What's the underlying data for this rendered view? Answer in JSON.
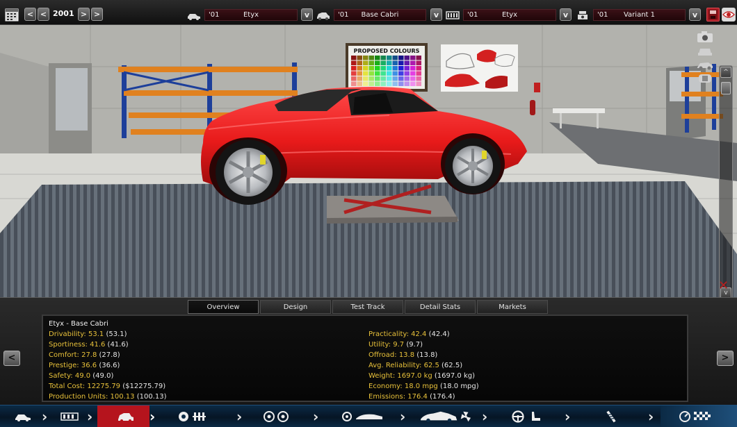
{
  "topbar": {
    "calendar_icon": "calendar-icon",
    "year": "2001",
    "prev_label": "<",
    "prev_fast_label": "<",
    "next_label": ">",
    "next_fast_label": ">",
    "dropdown_label": "v",
    "selectors": [
      {
        "year": "'01",
        "name": "Etyx",
        "icon": "car-factory-icon"
      },
      {
        "year": "'01",
        "name": "Base Cabri",
        "icon": "car-body-icon"
      },
      {
        "year": "'01",
        "name": "Etyx",
        "icon": "engine-block-icon"
      },
      {
        "year": "'01",
        "name": "Variant 1",
        "icon": "engine-variant-icon"
      }
    ],
    "save_icon": "save-icon",
    "view_icon": "eye-icon"
  },
  "scene": {
    "poster_text": "PROPOSED COLOURS",
    "car_color": "#e81a1a",
    "scroll_up": "^",
    "scroll_down": "v",
    "close_icon": "close-icon",
    "view_icons": [
      "camera-icon",
      "car-front-icon",
      "car-side-icon",
      "car-top-icon"
    ]
  },
  "tabs": [
    "Overview",
    "Design",
    "Test Track",
    "Detail Stats",
    "Markets"
  ],
  "active_tab": "Overview",
  "stats": {
    "title": "Etyx - Base Cabri",
    "left": [
      {
        "label": "Drivability:",
        "value": "53.1",
        "ref": "(53.1)"
      },
      {
        "label": "Sportiness:",
        "value": "41.6",
        "ref": "(41.6)"
      },
      {
        "label": "Comfort:",
        "value": "27.8",
        "ref": "(27.8)"
      },
      {
        "label": "Prestige:",
        "value": "36.6",
        "ref": "(36.6)"
      },
      {
        "label": "Safety:",
        "value": "49.0",
        "ref": "(49.0)"
      },
      {
        "label": "Total Cost:",
        "value": "12275.79",
        "ref": "($12275.79)"
      },
      {
        "label": "Production Units:",
        "value": "100.13",
        "ref": "(100.13)"
      }
    ],
    "right": [
      {
        "label": "Practicality:",
        "value": "42.4",
        "ref": "(42.4)"
      },
      {
        "label": "Utility:",
        "value": "9.7",
        "ref": "(9.7)"
      },
      {
        "label": "Offroad:",
        "value": "13.8",
        "ref": "(13.8)"
      },
      {
        "label": "Avg. Reliability:",
        "value": "62.5",
        "ref": "(62.5)"
      },
      {
        "label": "Weight:",
        "value": "1697.0 kg",
        "ref": "(1697.0 kg)"
      },
      {
        "label": "Economy:",
        "value": "18.0 mpg",
        "ref": "(18.0 mpg)"
      },
      {
        "label": "Emissions:",
        "value": "176.4",
        "ref": "(176.4)"
      }
    ]
  },
  "nav": {
    "prev_label": "<",
    "next_label": ">",
    "chevron": "›",
    "items": [
      "car-factory-icon",
      "chassis-icon",
      "car-body-icon",
      "engine-icon",
      "wheels-icon",
      "car-trim-icon",
      "car-design-icon",
      "steering-seat-icon",
      "suspension-icon",
      "test-gauge-icon"
    ]
  },
  "colors": {
    "accent_red": "#b5141d",
    "stat_yellow": "#e8c13a",
    "nav_blue": "#061525"
  }
}
